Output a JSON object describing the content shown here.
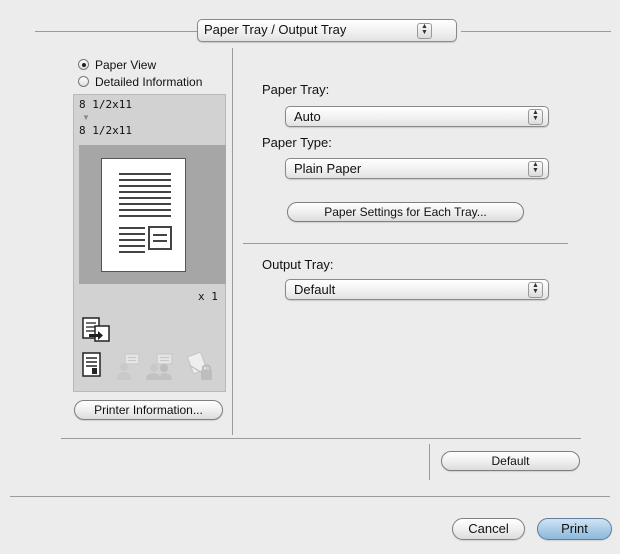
{
  "header": {
    "section_popup": "Paper Tray / Output Tray"
  },
  "preview": {
    "view_options": [
      {
        "label": "Paper View",
        "selected": true
      },
      {
        "label": "Detailed Information",
        "selected": false
      }
    ],
    "source_size": "8 1/2x11",
    "output_size": "8 1/2x11",
    "copies": "x 1",
    "printer_info_button": "Printer Information..."
  },
  "settings": {
    "paper_tray_label": "Paper Tray:",
    "paper_tray_value": "Auto",
    "paper_type_label": "Paper Type:",
    "paper_type_value": "Plain Paper",
    "paper_settings_button": "Paper Settings for Each Tray...",
    "output_tray_label": "Output Tray:",
    "output_tray_value": "Default"
  },
  "footer": {
    "default_button": "Default",
    "cancel_button": "Cancel",
    "print_button": "Print"
  },
  "icons": [
    "output-tray-icon",
    "document-icon",
    "user-icon",
    "users-icon",
    "secure-print-icon"
  ]
}
